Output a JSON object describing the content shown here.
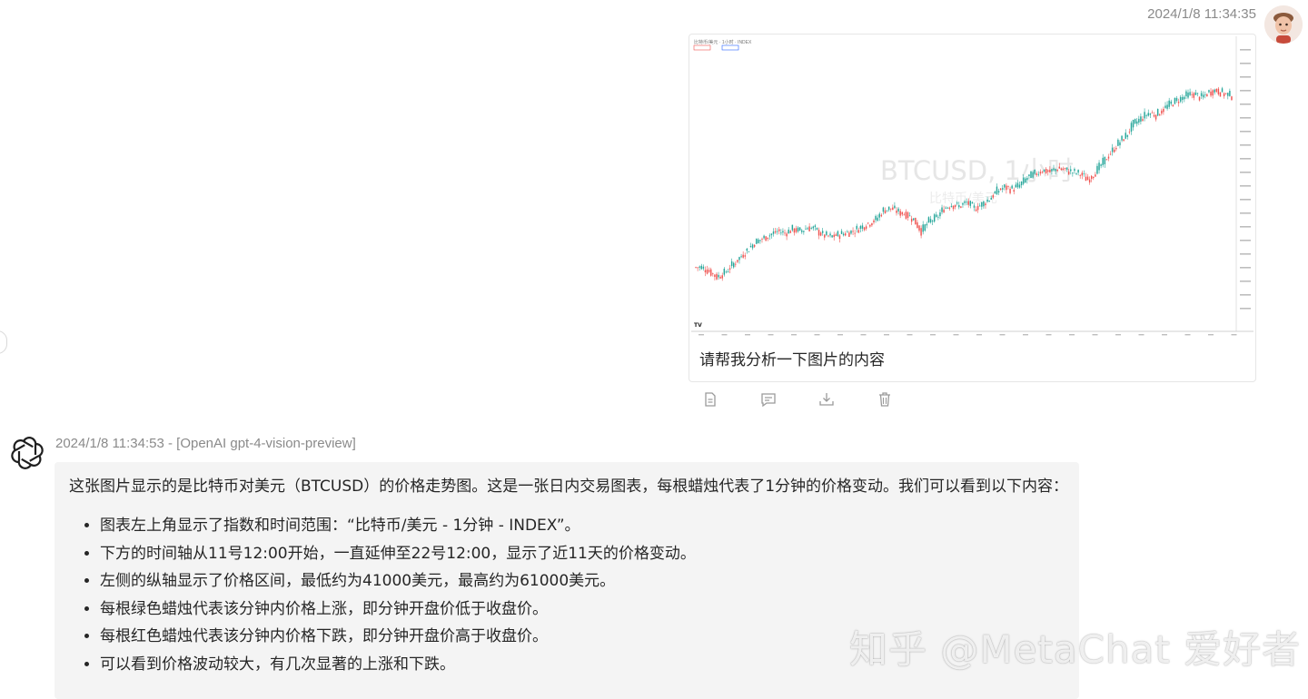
{
  "user_message": {
    "timestamp": "2024/1/8 11:34:35",
    "text": "请帮我分析一下图片的内容",
    "image": {
      "watermark_title": "BTCUSD, 1小时",
      "watermark_subtitle": "比特币/美元",
      "header": "比特币/美元 · 1小时 · INDEX"
    }
  },
  "message_actions": [
    "copy-icon",
    "comment-icon",
    "download-icon",
    "delete-icon"
  ],
  "assistant_message": {
    "meta": "2024/1/8 11:34:53 - [OpenAI gpt-4-vision-preview]",
    "intro": "这张图片显示的是比特币对美元（BTCUSD）的价格走势图。这是一张日内交易图表，每根蜡烛代表了1分钟的价格变动。我们可以看到以下内容：",
    "items": [
      "图表左上角显示了指数和时间范围：“比特币/美元 - 1分钟 - INDEX”。",
      "下方的时间轴从11号12:00开始，一直延伸至22号12:00，显示了近11天的价格变动。",
      "左侧的纵轴显示了价格区间，最低约为41000美元，最高约为61000美元。",
      "每根绿色蜡烛代表该分钟内价格上涨，即分钟开盘价低于收盘价。",
      "每根红色蜡烛代表该分钟内价格下跌，即分钟开盘价高于收盘价。",
      "可以看到价格波动较大，有几次显著的上涨和下跌。"
    ]
  },
  "watermark": "知乎 @MetaChat 爱好者",
  "colors": {
    "up": "#26a69a",
    "down": "#ef5350",
    "muted": "#8a8a8a",
    "bubble": "#f4f4f4"
  },
  "chart_data": {
    "type": "candlestick",
    "title": "BTCUSD, 1小时",
    "candles_close_rel": [
      0.05,
      0.03,
      0.0,
      0.02,
      0.06,
      0.1,
      0.14,
      0.18,
      0.2,
      0.22,
      0.24,
      0.23,
      0.25,
      0.24,
      0.26,
      0.25,
      0.22,
      0.21,
      0.22,
      0.23,
      0.24,
      0.26,
      0.28,
      0.3,
      0.35,
      0.36,
      0.34,
      0.33,
      0.3,
      0.24,
      0.29,
      0.31,
      0.36,
      0.38,
      0.37,
      0.39,
      0.36,
      0.38,
      0.41,
      0.45,
      0.47,
      0.46,
      0.48,
      0.52,
      0.54,
      0.56,
      0.55,
      0.57,
      0.56,
      0.55,
      0.54,
      0.51,
      0.55,
      0.6,
      0.65,
      0.7,
      0.74,
      0.8,
      0.83,
      0.86,
      0.85,
      0.88,
      0.91,
      0.93,
      0.95,
      0.96,
      0.94,
      0.97,
      0.98,
      0.96,
      0.95
    ]
  }
}
